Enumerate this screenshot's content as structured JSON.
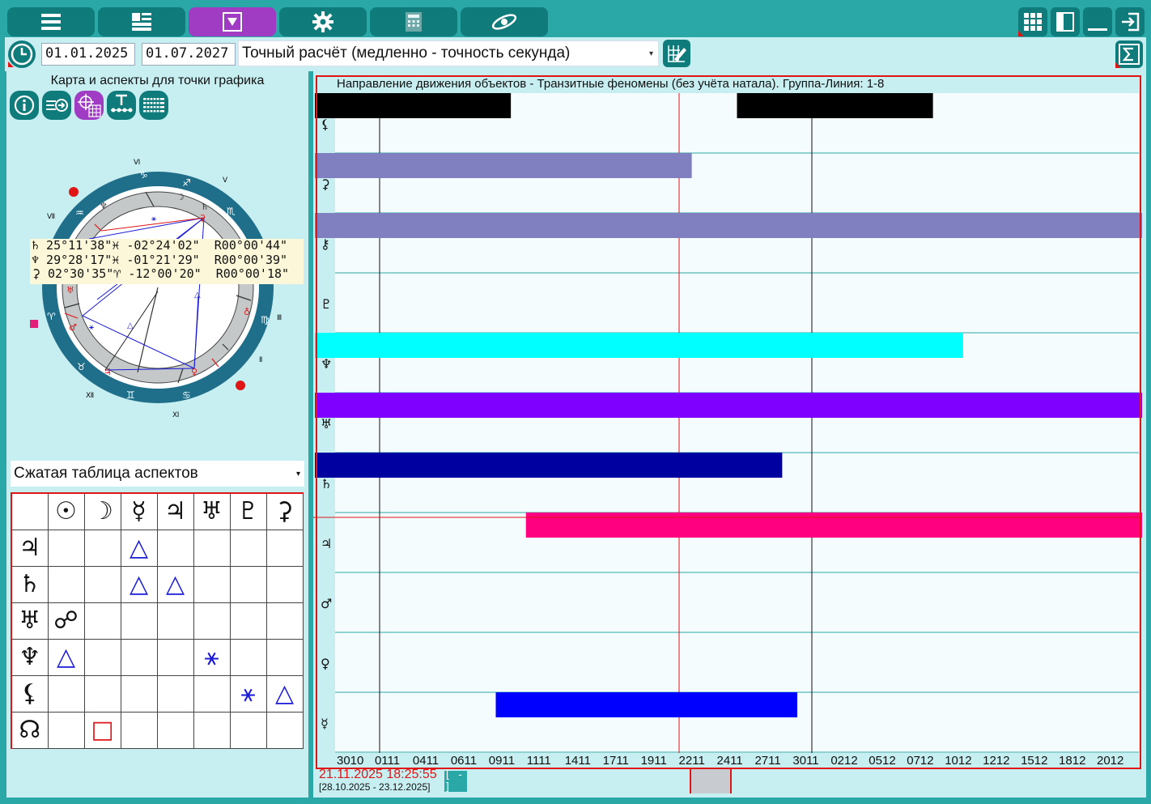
{
  "toolbar": {
    "buttons": [
      "menu",
      "layout",
      "filter",
      "settings",
      "calculator",
      "ephemeris"
    ],
    "active": "filter"
  },
  "dates": {
    "start": "01.01.2025",
    "end": "01.07.2027",
    "calc_mode": "Точный расчёт (медленно - точность секунда)"
  },
  "left": {
    "title": "Карта и аспекты для точки графика",
    "planet_rows": [
      "♄ 25°11'38\"♓ -02°24'02\"  R00°00'44\"",
      "♆ 29°28'17\"♓ -01°21'29\"  R00°00'39\"",
      "⚳ 02°30'35\"♈ -12°00'20\"  R00°00'18\""
    ],
    "aspect_table_mode": "Сжатая таблица аспектов",
    "aspect_table": {
      "columns": [
        "☉",
        "☽",
        "☿",
        "♃",
        "♅",
        "♇",
        "⚳"
      ],
      "rows": [
        {
          "planet": "♃",
          "cells": [
            "",
            "",
            "△",
            "",
            "",
            "",
            ""
          ]
        },
        {
          "planet": "♄",
          "cells": [
            "",
            "",
            "△",
            "△",
            "",
            "",
            ""
          ]
        },
        {
          "planet": "♅",
          "cells": [
            "☍",
            "",
            "",
            "",
            "",
            "",
            ""
          ]
        },
        {
          "planet": "♆",
          "cells": [
            "△",
            "",
            "",
            "",
            "⚹",
            "",
            ""
          ]
        },
        {
          "planet": "⚸",
          "cells": [
            "",
            "",
            "",
            "",
            "",
            "⚹",
            "△"
          ]
        },
        {
          "planet": "☊",
          "cells": [
            "",
            "□",
            "",
            "",
            "",
            "",
            ""
          ]
        }
      ]
    },
    "colors": {
      "trine": "#1919d8",
      "sextile": "#1919d8",
      "square": "#e01515",
      "opposition": "#111111"
    }
  },
  "chart": {
    "title": "Направление движения объектов - Транзитные феномены (без учёта натала). Группа-Линия: 1-8",
    "current_date": "21.11.2025 18:25:55",
    "range": "[28.10.2025 - 23.12.2025]",
    "collapse_label": "[ - ]",
    "row_symbols": [
      "⚸",
      "⚳",
      "⚷",
      "♇",
      "♆",
      "♅",
      "♄",
      "♃",
      "♂",
      "♀",
      "☿"
    ],
    "x_ticks": [
      "3010",
      "0111",
      "0411",
      "0611",
      "0911",
      "1111",
      "1411",
      "1711",
      "1911",
      "2211",
      "2411",
      "2711",
      "3011",
      "0212",
      "0512",
      "0712",
      "1012",
      "1212",
      "1512",
      "1812",
      "2012"
    ],
    "bars_colors": [
      "#000000",
      "#8080c0",
      "#00ffff",
      "#8000ff",
      "#0000a0",
      "#ff0080",
      "#0000ff"
    ]
  },
  "chart_data": {
    "type": "timeline",
    "title": "Направление движения объектов - Транзитные феномены (без учёта натала). Группа-Линия: 1-8",
    "x_range": [
      "28.10.2025",
      "23.12.2025"
    ],
    "series": [
      {
        "name": "⚸",
        "segments": [
          [
            "28.10.2025",
            "10.11.2025"
          ],
          [
            "25.11.2025",
            "08.12.2025"
          ]
        ],
        "color": "#000000"
      },
      {
        "name": "⚳",
        "segments": [
          [
            "28.10.2025",
            "22.11.2025"
          ]
        ],
        "color": "#8080c0"
      },
      {
        "name": "⚷",
        "segments": [
          [
            "28.10.2025",
            "23.12.2025"
          ]
        ],
        "color": "#8080c0"
      },
      {
        "name": "♇",
        "segments": []
      },
      {
        "name": "♆",
        "segments": [
          [
            "28.10.2025",
            "10.12.2025"
          ]
        ],
        "color": "#00ffff"
      },
      {
        "name": "♅",
        "segments": [
          [
            "28.10.2025",
            "23.12.2025"
          ]
        ],
        "color": "#8000ff"
      },
      {
        "name": "♄",
        "segments": [
          [
            "28.10.2025",
            "28.11.2025"
          ]
        ],
        "color": "#0000a0"
      },
      {
        "name": "♃",
        "segments": [
          [
            "11.11.2025",
            "23.12.2025"
          ]
        ],
        "color": "#ff0080"
      },
      {
        "name": "♂",
        "segments": []
      },
      {
        "name": "♀",
        "segments": []
      },
      {
        "name": "☿",
        "segments": [
          [
            "09.11.2025",
            "29.11.2025"
          ]
        ],
        "color": "#0000ff"
      }
    ],
    "current_marker": "21.11.2025 18:25:55"
  }
}
